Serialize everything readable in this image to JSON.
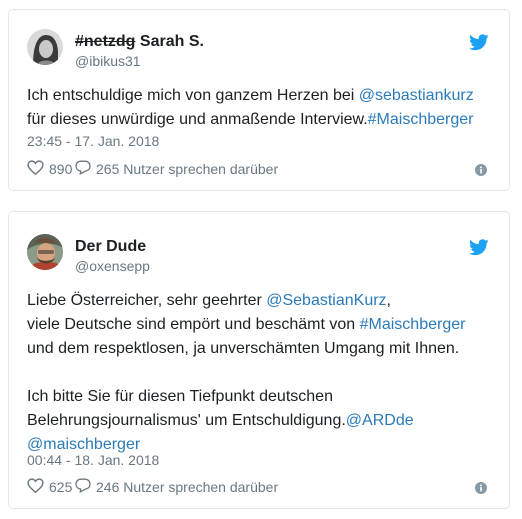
{
  "tweets": [
    {
      "name_strike": "#netzdg",
      "name": " Sarah S.",
      "handle": "@ibikus31",
      "lines": [
        [
          {
            "t": "Ich entschuldige mich von ganzem Herzen bei "
          },
          {
            "t": "@sebastiankurz",
            "link": true
          }
        ],
        [
          {
            "t": "für dieses unwürdige und anmaßende Interview."
          },
          {
            "t": "#Maischberger",
            "link": true
          }
        ]
      ],
      "timestamp": "23:45 - 17. Jan. 2018",
      "likes": "890",
      "replies_text": "265 Nutzer sprechen darüber",
      "icons": {
        "brand": "twitter-bird-icon",
        "like": "heart-icon",
        "reply": "speech-bubble-icon",
        "info": "info-icon"
      }
    },
    {
      "name": "Der Dude",
      "handle": "@oxensepp",
      "lines": [
        [
          {
            "t": "Liebe Österreicher, sehr geehrter "
          },
          {
            "t": "@SebastianKurz",
            "link": true
          },
          {
            "t": ","
          }
        ],
        [
          {
            "t": "viele Deutsche sind empört und beschämt von "
          },
          {
            "t": "#Maischberger",
            "link": true
          }
        ],
        [
          {
            "t": "und dem respektlosen, ja unverschämten Umgang mit Ihnen."
          }
        ],
        [],
        [
          {
            "t": "Ich bitte Sie für diesen Tiefpunkt deutschen"
          }
        ],
        [
          {
            "t": "Belehrungsjournalismus' um Entschuldigung."
          },
          {
            "t": "@ARDde",
            "link": true
          }
        ],
        [
          {
            "t": "@maischberger",
            "link": true
          }
        ]
      ],
      "timestamp": "00:44 - 18. Jan. 2018",
      "likes": "625",
      "replies_text": "246 Nutzer sprechen darüber",
      "icons": {
        "brand": "twitter-bird-icon",
        "like": "heart-icon",
        "reply": "speech-bubble-icon",
        "info": "info-icon"
      }
    }
  ],
  "colors": {
    "link": "#2b7bb9",
    "twitter_blue": "#1da1f2",
    "muted": "#697882",
    "text": "#1c2022",
    "border": "#e1e8ed"
  }
}
